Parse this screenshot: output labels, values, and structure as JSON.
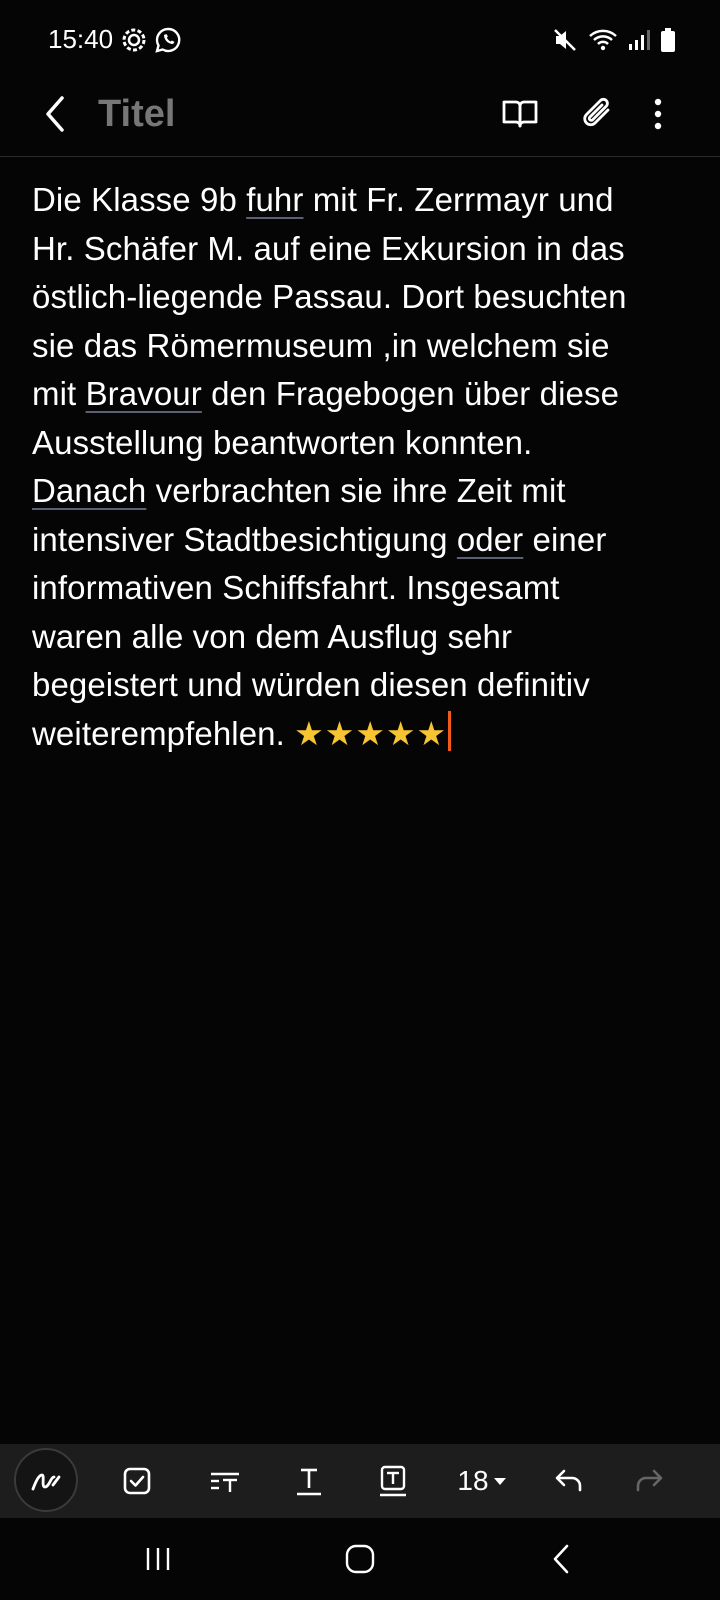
{
  "status_bar": {
    "time": "15:40",
    "left_icons": [
      "settings-gear-icon",
      "whatsapp-icon"
    ],
    "right_icons": [
      "mute-icon",
      "wifi-icon",
      "signal-icon",
      "battery-icon"
    ]
  },
  "app_bar": {
    "title": "Titel",
    "actions": [
      "reading-mode-icon",
      "attach-icon",
      "more-options-icon"
    ]
  },
  "note": {
    "lines": [
      [
        "Die Klasse 9b ",
        "fuhr",
        " mit Fr. Zerrmayr und"
      ],
      [
        "Hr. Schäfer M. auf eine Exkursion in das"
      ],
      [
        "östlich-liegende Passau. Dort besuchten"
      ],
      [
        "sie das Römermuseum ,in welchem sie"
      ],
      [
        "mit ",
        "Bravour",
        " den Fragebogen über diese"
      ],
      [
        "Ausstellung beantworten konnten."
      ],
      [
        "Danach",
        " verbrachten sie ihre Zeit mit"
      ],
      [
        "intensiver Stadtbesichtigung ",
        "oder",
        " einer"
      ],
      [
        "informativen Schiffsfahrt. Insgesamt"
      ],
      [
        "waren alle von dem Ausflug sehr"
      ],
      [
        "begeistert und würden diesen definitiv"
      ],
      [
        "weiterempfehlen. "
      ]
    ],
    "stars": "★★★★★",
    "star_color": "#f7c531",
    "cursor_color": "#f25a1c",
    "underline_color": "#5b6170"
  },
  "toolbar": {
    "font_size": "18",
    "tools": [
      "pen-icon",
      "checkbox-icon",
      "text-style-icon",
      "text-format-icon",
      "text-highlight-icon",
      "font-size-dropdown",
      "undo-icon",
      "redo-icon"
    ]
  },
  "nav_bar": {
    "buttons": [
      "recent-apps-icon",
      "home-icon",
      "back-icon"
    ]
  },
  "colors": {
    "background": "#050505",
    "toolbar": "#1d1d1d",
    "title": "#777777"
  }
}
